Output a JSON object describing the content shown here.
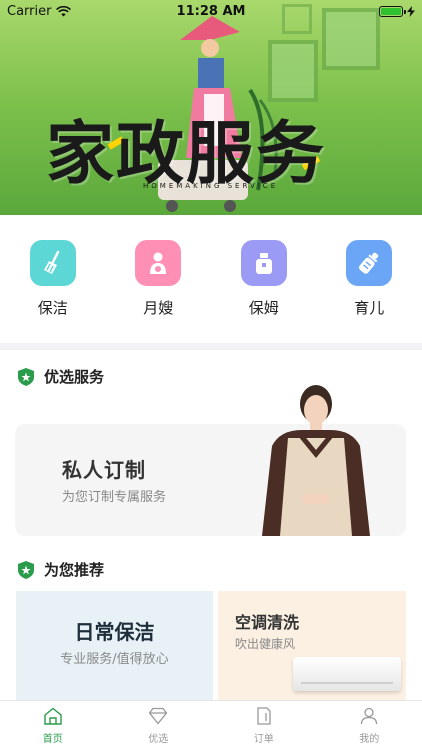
{
  "status_bar": {
    "carrier": "Carrier",
    "time": "11:28 AM"
  },
  "banner": {
    "title": "家政服务",
    "subtitle": "HOMEMAKING SERVICE"
  },
  "categories": [
    {
      "label": "保洁",
      "icon": "broom-icon",
      "color": "#5dd6d6"
    },
    {
      "label": "月嫂",
      "icon": "mother-baby-icon",
      "color": "#ff8fb5"
    },
    {
      "label": "保姆",
      "icon": "housekeeper-icon",
      "color": "#9b9bf5"
    },
    {
      "label": "育儿",
      "icon": "baby-bottle-icon",
      "color": "#6aa6f5"
    }
  ],
  "featured": {
    "title": "优选服务",
    "card": {
      "title": "私人订制",
      "subtitle": "为您订制专属服务"
    }
  },
  "recommend": {
    "title": "为您推荐",
    "cards": [
      {
        "title": "日常保洁",
        "subtitle": "专业服务/值得放心"
      },
      {
        "title": "空调清洗",
        "subtitle": "吹出健康风"
      }
    ]
  },
  "tabbar": {
    "items": [
      {
        "label": "首页",
        "icon": "home-icon",
        "active": true
      },
      {
        "label": "优选",
        "icon": "diamond-icon",
        "active": false
      },
      {
        "label": "订单",
        "icon": "order-icon",
        "active": false
      },
      {
        "label": "我的",
        "icon": "user-icon",
        "active": false
      }
    ]
  },
  "colors": {
    "accent": "#2a9c4c",
    "section_icon": "#2a9c4c"
  }
}
